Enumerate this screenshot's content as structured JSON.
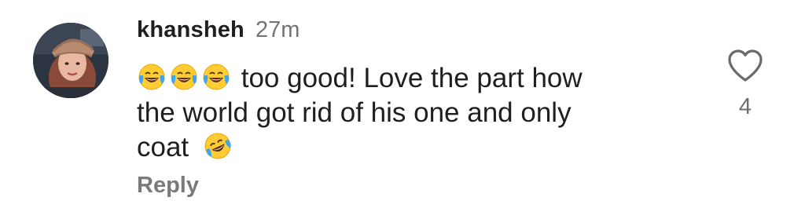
{
  "comment": {
    "username": "khansheh",
    "timestamp": "27m",
    "text_lines": [
      "too good! Love the part how",
      "the world got rid of his one and only",
      "coat"
    ],
    "emojis": [
      "face-with-tears-of-joy",
      "face-with-tears-of-joy",
      "face-with-tears-of-joy",
      "rolling-on-the-floor-laughing"
    ],
    "reply_label": "Reply",
    "like_count": "4",
    "like_icon": "heart-outline-icon"
  },
  "colors": {
    "username": "#1f1f1f",
    "muted": "#737373",
    "emoji_yellow": "#ffcc33"
  }
}
